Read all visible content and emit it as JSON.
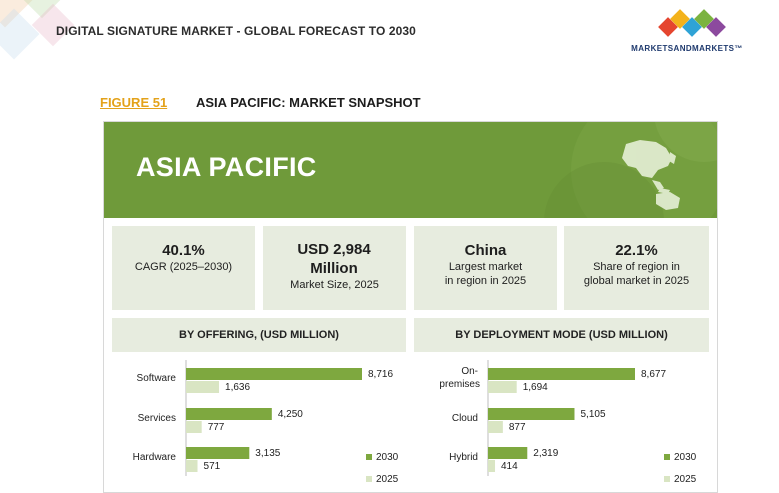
{
  "header": {
    "report_title": "DIGITAL SIGNATURE MARKET - GLOBAL FORECAST TO 2030",
    "brand": "MARKETSANDMARKETS™"
  },
  "figure": {
    "label": "FIGURE 51",
    "title": "ASIA PACIFIC: MARKET SNAPSHOT"
  },
  "banner": {
    "region": "ASIA PACIFIC",
    "map_icon": "asia-pacific-map-icon"
  },
  "stats": [
    {
      "big": "40.1%",
      "lines": [
        "CAGR (2025–2030)"
      ]
    },
    {
      "big": "USD 2,984 Million",
      "lines": [
        "Market Size, 2025"
      ]
    },
    {
      "big": "China",
      "lines": [
        "Largest market",
        "in region in 2025"
      ]
    },
    {
      "big": "22.1%",
      "lines": [
        "Share of region in",
        "global market in 2025"
      ]
    }
  ],
  "colors": {
    "accent_2030": "#7ea83f",
    "accent_2025": "#d9e5c3",
    "banner": "#6f9a3a",
    "figure_label": "#e3a21a"
  },
  "chart_data": [
    {
      "type": "bar",
      "title": "BY OFFERING, (USD MILLION)",
      "orientation": "horizontal",
      "categories": [
        "Software",
        "Services",
        "Hardware"
      ],
      "series": [
        {
          "name": "2030",
          "values": [
            8716,
            4250,
            3135
          ]
        },
        {
          "name": "2025",
          "values": [
            1636,
            777,
            571
          ]
        }
      ],
      "legend": "bottom-right"
    },
    {
      "type": "bar",
      "title": "BY DEPLOYMENT MODE (USD MILLION)",
      "orientation": "horizontal",
      "categories": [
        "On-premises",
        "Cloud",
        "Hybrid"
      ],
      "series": [
        {
          "name": "2030",
          "values": [
            8677,
            5105,
            2319
          ]
        },
        {
          "name": "2025",
          "values": [
            1694,
            877,
            414
          ]
        }
      ],
      "legend": "bottom-right"
    }
  ]
}
